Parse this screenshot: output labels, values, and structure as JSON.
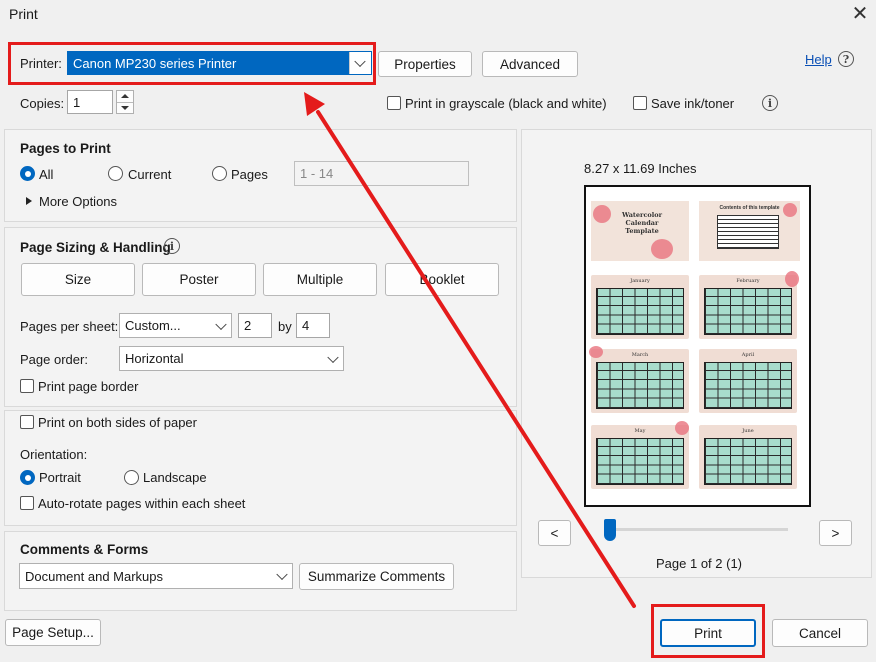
{
  "window": {
    "title": "Print"
  },
  "printer": {
    "label": "Printer:",
    "selected": "Canon MP230 series Printer"
  },
  "buttons": {
    "properties": "Properties",
    "advanced": "Advanced",
    "help": "Help",
    "page_setup": "Page Setup...",
    "print": "Print",
    "cancel": "Cancel"
  },
  "copies": {
    "label": "Copies:",
    "value": "1"
  },
  "options": {
    "grayscale": "Print in grayscale (black and white)",
    "save_ink": "Save ink/toner"
  },
  "pages_to_print": {
    "heading": "Pages to Print",
    "all": "All",
    "current": "Current",
    "pages": "Pages",
    "pages_value": "1 - 14",
    "more_options": "More Options"
  },
  "sizing": {
    "heading": "Page Sizing & Handling",
    "tabs": [
      "Size",
      "Poster",
      "Multiple",
      "Booklet"
    ],
    "pages_per_sheet_label": "Pages per sheet:",
    "pages_per_sheet_value": "Custom...",
    "cols": "2",
    "by": "by",
    "rows": "4",
    "page_order_label": "Page order:",
    "page_order_value": "Horizontal",
    "border": "Print page border"
  },
  "duplex": {
    "both_sides": "Print on both sides of paper",
    "orientation_label": "Orientation:",
    "portrait": "Portrait",
    "landscape": "Landscape",
    "auto_rotate": "Auto-rotate pages within each sheet"
  },
  "comments": {
    "heading": "Comments & Forms",
    "value": "Document and Markups",
    "summarize": "Summarize Comments"
  },
  "preview": {
    "size": "8.27 x 11.69 Inches",
    "page_info": "Page 1 of 2 (1)",
    "prev": "<",
    "next": ">",
    "slider_position": 0,
    "cover_title": "Watercolor Calendar Template",
    "contents_title": "Contents of this template",
    "months": [
      "January",
      "February",
      "March",
      "April",
      "May",
      "June"
    ]
  },
  "colors": {
    "accent": "#0067c0",
    "highlight": "#e41b1b"
  }
}
